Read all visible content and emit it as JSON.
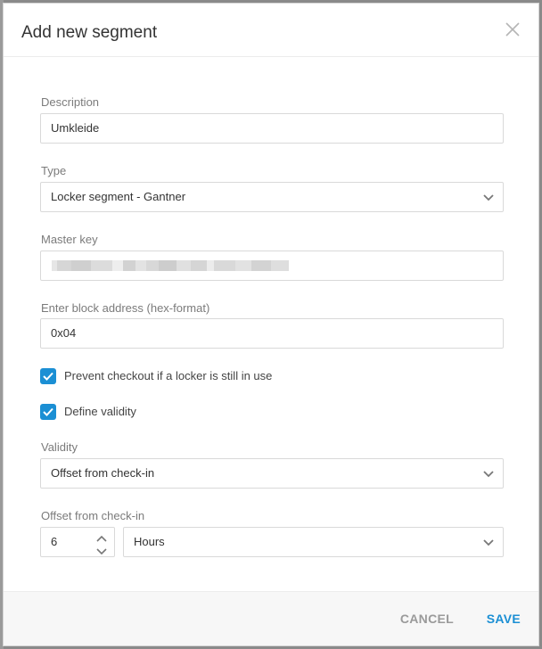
{
  "modal": {
    "title": "Add new segment"
  },
  "description": {
    "label": "Description",
    "value": "Umkleide"
  },
  "type": {
    "label": "Type",
    "selected": "Locker segment - Gantner"
  },
  "master_key": {
    "label": "Master key"
  },
  "block_address": {
    "label": "Enter block address (hex-format)",
    "value": "0x04"
  },
  "checkboxes": {
    "prevent_checkout": {
      "label": "Prevent checkout if a locker is still in use",
      "checked": true
    },
    "define_validity": {
      "label": "Define validity",
      "checked": true
    }
  },
  "validity": {
    "label": "Validity",
    "selected": "Offset from check-in"
  },
  "offset": {
    "label": "Offset from check-in",
    "value": "6",
    "unit": "Hours"
  },
  "footer": {
    "cancel_label": "CANCEL",
    "save_label": "SAVE"
  },
  "colors": {
    "accent": "#1b8fd4",
    "muted_button": "#9a9a9a"
  }
}
